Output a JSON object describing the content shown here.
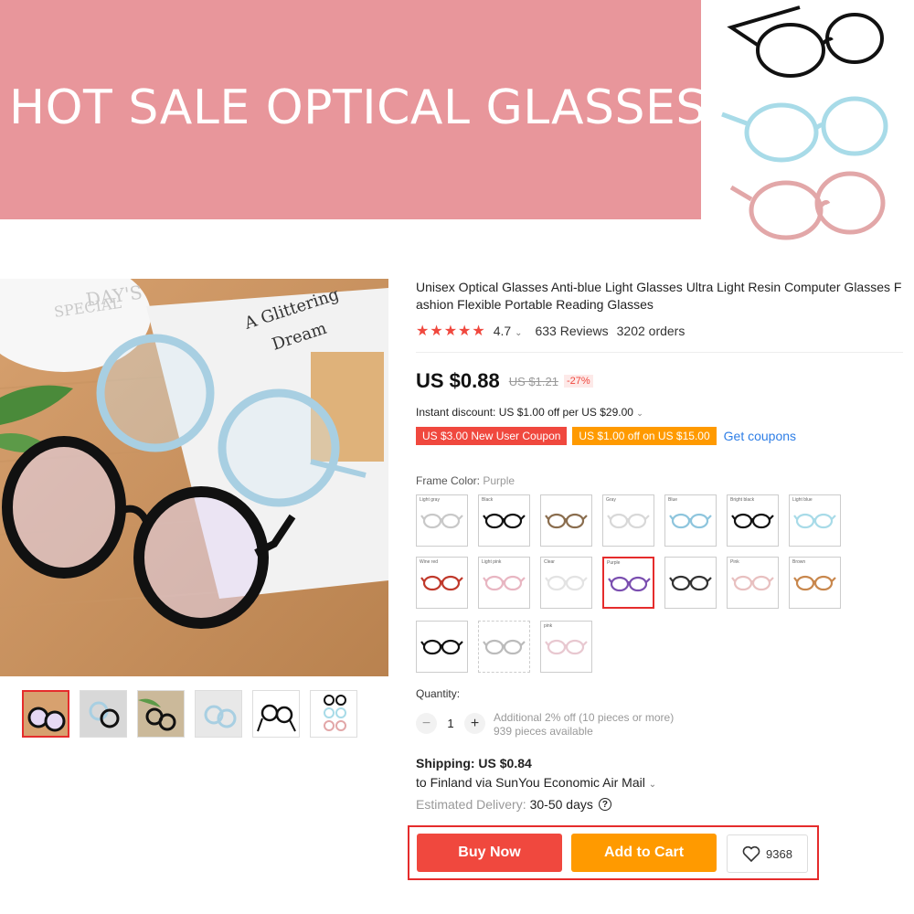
{
  "banner": {
    "title": "HOT SALE OPTICAL GLASSES",
    "colors": {
      "background": "#e8969b",
      "text": "#ffffff"
    }
  },
  "gallery": {
    "image_text": [
      "DAY'S",
      "SPECIAL",
      "A Glittering",
      "Dream"
    ],
    "thumbnail_count": 6,
    "active_thumbnail": 1
  },
  "product": {
    "title": "Unisex Optical Glasses Anti-blue Light Glasses Ultra Light Resin Computer Glasses Fashion Flexible Portable Reading Glasses",
    "stars": "★★★★★",
    "rating": "4.7",
    "reviews": "633 Reviews",
    "orders": "3202 orders",
    "price": "US $0.88",
    "old_price": "US $1.21",
    "discount": "-27%",
    "instant_discount": "Instant discount: US $1.00 off per US $29.00",
    "coupons": [
      "US $3.00 New User Coupon",
      "US $1.00 off on US $15.00"
    ],
    "get_coupons": "Get coupons"
  },
  "frame_color": {
    "label": "Frame Color:",
    "selected": "Purple",
    "swatch_labels": [
      "Light gray",
      "Black",
      "",
      "Gray",
      "Blue",
      "Bright black",
      "Light blue",
      "Wine red",
      "Light pink",
      "Clear",
      "Purple",
      "",
      "Pink",
      "Brown",
      "",
      "",
      "pink"
    ]
  },
  "quantity": {
    "label": "Quantity:",
    "value": "1",
    "minus": "−",
    "plus": "+",
    "note_line1": "Additional 2% off (10 pieces or more)",
    "note_line2": "939 pieces available"
  },
  "shipping": {
    "cost": "Shipping: US $0.84",
    "route": "to Finland via SunYou Economic Air Mail",
    "delivery_label": "Estimated Delivery:",
    "delivery_value": "30-50 days"
  },
  "actions": {
    "buy_now": "Buy Now",
    "add_to_cart": "Add to Cart",
    "wishlist_count": "9368",
    "colors": {
      "buy": "#f0483e",
      "cart": "#ff9a00",
      "highlight": "#e52c2c"
    }
  }
}
